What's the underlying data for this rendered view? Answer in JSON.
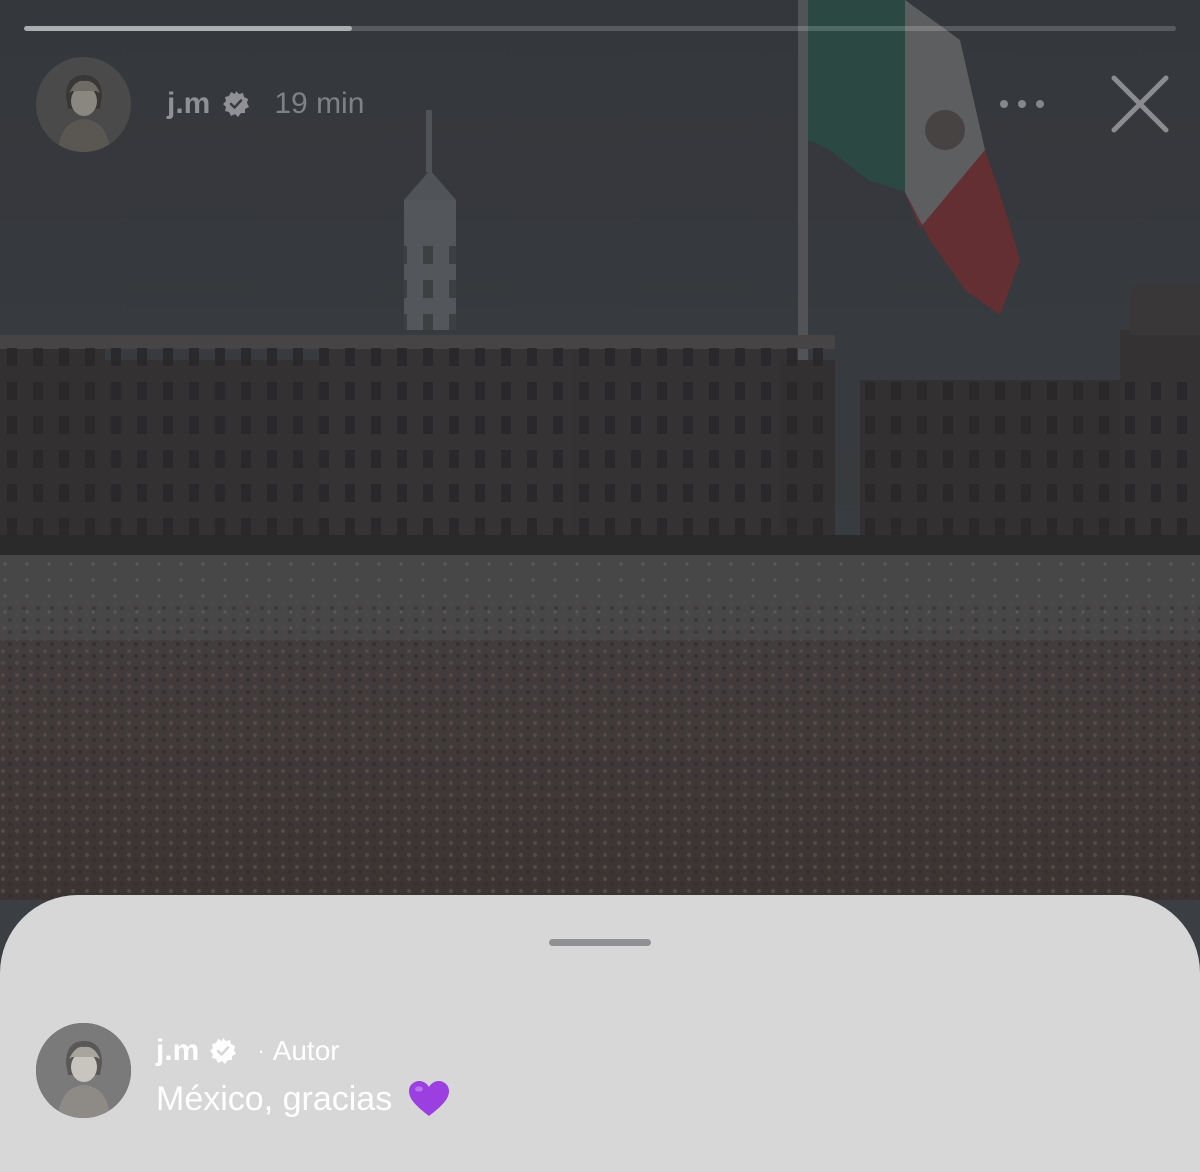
{
  "story": {
    "progress_fraction": 0.285,
    "author": {
      "username": "j.m",
      "verified": true,
      "avatar_icon": "person-portrait-icon"
    },
    "timestamp": "19 min",
    "controls": {
      "more_icon": "more-horizontal-icon",
      "close_icon": "close-icon"
    }
  },
  "comments_sheet": {
    "comment": {
      "username": "j.m",
      "verified": true,
      "separator": "·",
      "role_label": "Autor",
      "text": "México, gracias",
      "emoji_icon": "purple-heart-icon"
    }
  },
  "colors": {
    "sheet_background": "#d7d7d8",
    "heart": "#9b3fe0",
    "story_header_text": "#8f9196"
  }
}
